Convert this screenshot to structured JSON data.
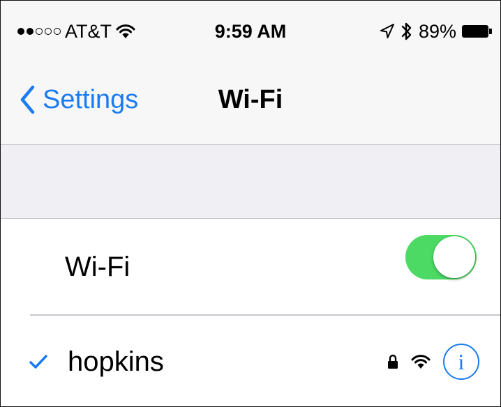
{
  "status_bar": {
    "carrier": "AT&T",
    "signal_filled": 2,
    "signal_total": 5,
    "time": "9:59 AM",
    "battery_percent": "89%",
    "icons": [
      "wifi-signal-icon",
      "location-arrow-icon",
      "bluetooth-icon",
      "battery-icon"
    ]
  },
  "nav": {
    "back_label": "Settings",
    "title": "Wi-Fi"
  },
  "wifi_row": {
    "label": "Wi-Fi",
    "toggle_on": true
  },
  "network": {
    "name": "hopkins",
    "selected": true,
    "secured": true,
    "icons": [
      "checkmark-icon",
      "lock-icon",
      "wifi-signal-icon",
      "info-icon"
    ]
  },
  "colors": {
    "accent": "#1a7bf2",
    "toggle_on": "#4cd964",
    "bar_background": "#f7f7f8",
    "group_background": "#efeff4"
  }
}
